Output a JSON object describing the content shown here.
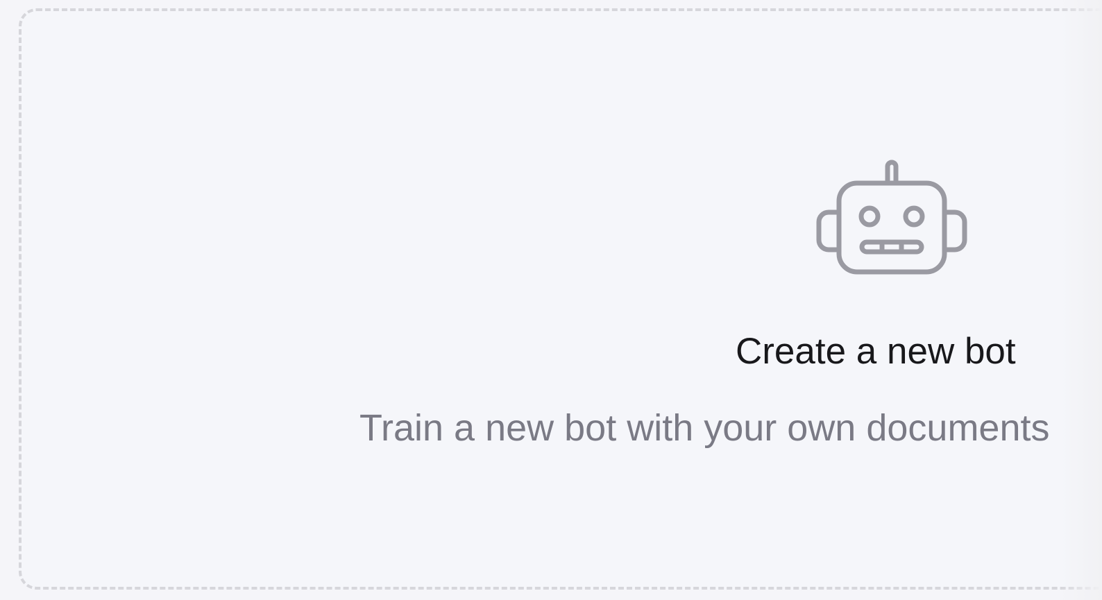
{
  "create_card": {
    "title": "Create a new bot",
    "subtitle": "Train a new bot with your own documents",
    "icon": "robot-icon"
  },
  "colors": {
    "background": "#f5f5f9",
    "border": "#d6d6db",
    "title": "#18181b",
    "subtitle": "#7a7a85",
    "icon": "#9a9aa2"
  }
}
